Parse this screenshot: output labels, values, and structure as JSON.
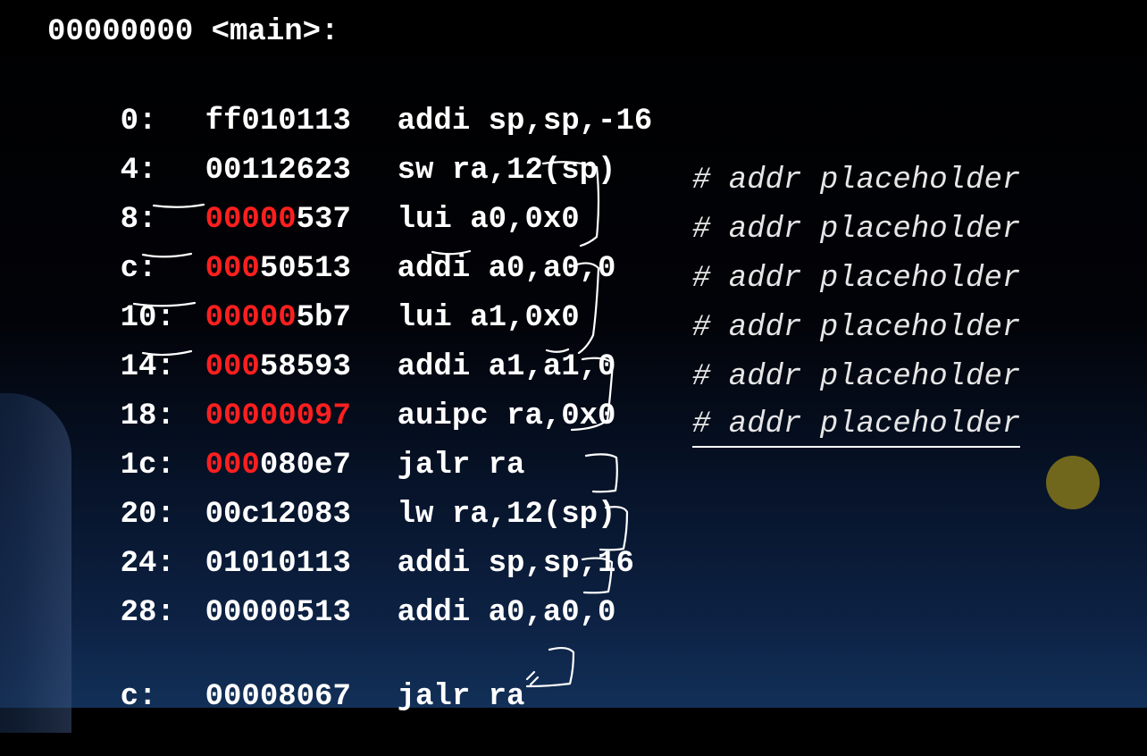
{
  "title": "00000000 <main>:",
  "rows": [
    {
      "addr": "0:",
      "hex_red": "",
      "hex_rest": "ff010113",
      "asm": "addi sp,sp,-16",
      "comment": ""
    },
    {
      "addr": "4:",
      "hex_red": "",
      "hex_rest": "00112623",
      "asm": "sw ra,12(sp)",
      "comment": ""
    },
    {
      "addr": "8:",
      "hex_red": "00000",
      "hex_rest": "537",
      "asm": "lui a0,0x0",
      "comment": "# addr placeholder"
    },
    {
      "addr": "c:",
      "hex_red": "000",
      "hex_rest": "50513",
      "asm": "addi a0,a0,0",
      "comment": "# addr placeholder"
    },
    {
      "addr": "10:",
      "hex_red": "00000",
      "hex_rest": "5b7",
      "asm": "lui a1,0x0",
      "comment": "# addr placeholder"
    },
    {
      "addr": "14:",
      "hex_red": "000",
      "hex_rest": "58593",
      "asm": "addi a1,a1,0",
      "comment": "# addr placeholder"
    },
    {
      "addr": "18:",
      "hex_red": "00000097",
      "hex_rest": "",
      "asm": "auipc ra,0x0",
      "comment": "# addr placeholder"
    },
    {
      "addr": "1c:",
      "hex_red": "000",
      "hex_rest": "080e7",
      "asm": "jalr ra",
      "comment": "# addr placeholder"
    },
    {
      "addr": "20:",
      "hex_red": "",
      "hex_rest": "00c12083",
      "asm": "lw ra,12(sp)",
      "comment": ""
    },
    {
      "addr": "24:",
      "hex_red": "",
      "hex_rest": "01010113",
      "asm": "addi sp,sp,16",
      "comment": ""
    },
    {
      "addr": "28:",
      "hex_red": "",
      "hex_rest": "00000513",
      "asm": "addi a0,a0,0",
      "comment": ""
    },
    {
      "addr": "c:",
      "hex_red": "",
      "hex_rest": "00008067",
      "asm": "jalr ra",
      "comment": ""
    }
  ],
  "colors": {
    "relocation_highlight": "#ff1f1f",
    "text": "#ffffff",
    "laser_pointer": "#7a6f1c"
  }
}
